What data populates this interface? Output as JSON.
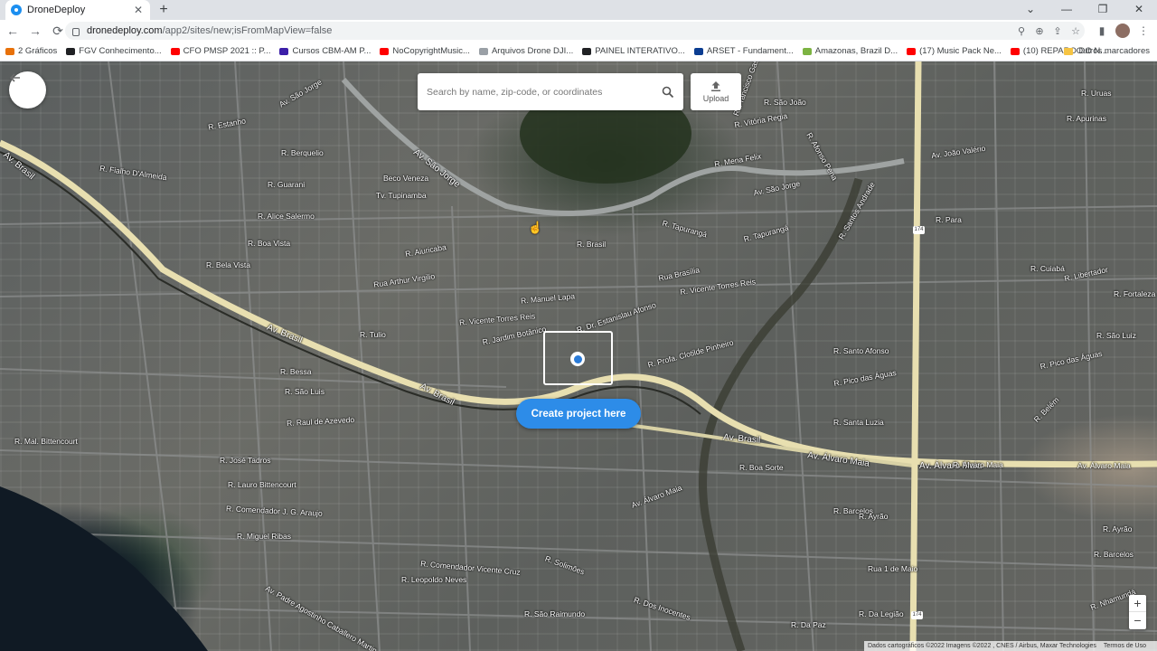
{
  "browser": {
    "tab_title": "DroneDeploy",
    "tab_close": "✕",
    "new_tab": "+",
    "url_host": "dronedeploy.com",
    "url_path": "/app2/sites/new;isFromMapView=false",
    "window_controls": {
      "tab_search": "⌄",
      "minimize": "—",
      "restore": "❐",
      "close": "✕"
    },
    "nav": {
      "back": "←",
      "forward": "→",
      "reload": "⟳"
    },
    "omnibox_icons": {
      "location": "⚲",
      "zoom": "⊕",
      "share": "⇪",
      "bookmark": "☆"
    },
    "toolbar_icons": {
      "sidebar": "▮",
      "menu": "⋮"
    }
  },
  "bookmarks": {
    "items": [
      {
        "label": "2 Gráficos",
        "color": "#e8710a"
      },
      {
        "label": "FGV Conhecimento...",
        "color": "#202124"
      },
      {
        "label": "CFO PMSP 2021 :: P...",
        "color": "#ff0000"
      },
      {
        "label": "Cursos CBM-AM P...",
        "color": "#3c1fa8"
      },
      {
        "label": "NoCopyrightMusic...",
        "color": "#ff0000"
      },
      {
        "label": "Arquivos Drone DJI...",
        "color": "#9aa0a6"
      },
      {
        "label": "PAINEL INTERATIVO...",
        "color": "#202124"
      },
      {
        "label": "ARSET - Fundament...",
        "color": "#0b3d91"
      },
      {
        "label": "Amazonas, Brazil D...",
        "color": "#7cb342"
      },
      {
        "label": "(17) Music Pack Ne...",
        "color": "#ff0000"
      },
      {
        "label": "(10) REPARO DO N...",
        "color": "#ff0000"
      }
    ],
    "more": "»",
    "other": "Outros marcadores"
  },
  "map": {
    "search_placeholder": "Search by name, zip-code, or coordinates",
    "upload_label": "Upload",
    "create_project_label": "Create project here",
    "zoom_in": "+",
    "zoom_out": "−",
    "route_badge": "174",
    "attribution": {
      "data": "Dados cartográficos ©2022 Imagens ©2022 , CNES / Airbus, Maxar Technologies",
      "terms": "Termos de Uso"
    },
    "streets": [
      "R. Estanho",
      "Av. São Jorge",
      "R. Berquelio",
      "R. Guarani",
      "R. Fialho D'Almeida",
      "Beco Veneza",
      "Tv. Tupinamba",
      "R. Alice Salermo",
      "R. Boa Vista",
      "R. Bela Vista",
      "R. Aiuricaba",
      "Rua Arthur Virgilio",
      "R. Brasil",
      "R. Tapurangá",
      "R. Tapurangá",
      "R. Vitória Regia",
      "R. Mena Felix",
      "Av. São Jorge",
      "R. Santos Andrade",
      "Rua Brasília",
      "R. Vicente Torres Reis",
      "R. Manuel Lapa",
      "R. Vicente Torres Reis",
      "R. Jardim Botânico",
      "R. Dr. Estanislau Afonso",
      "R. Profa. Clotilde Pinheiro",
      "R. Tulio",
      "R. Bessa",
      "R. São Luis",
      "R. Raul de Azevedo",
      "R. Mal. Bittencourt",
      "R. José Tadros",
      "R. Lauro Bittencourt",
      "R. Comendador J. G. Araujo",
      "R. Miguel Ribas",
      "R. Comendador Vicente Cruz",
      "R. Leopoldo Neves",
      "Av. Padre Agostinho Caballero Martin",
      "R. Santo Afonso",
      "R. Pico das Águas",
      "R. Santa Luzia",
      "R. Boa Sorte",
      "R. Barcelos",
      "Rua 1 de Maio",
      "R. Da Paz",
      "R. Solimões",
      "R. Dos Inocentes",
      "R. São Raimundo",
      "R. Para",
      "R. Cuiabá",
      "R. Libertador",
      "R. Fortaleza",
      "R. Pico das Águas",
      "R. Belém",
      "R. São Luiz",
      "R. Nhamundá",
      "Av. João Valério",
      "R. Apurinas",
      "R. Uruas",
      "R. São João",
      "R. Francisco Gaspar",
      "R. Afonso Pena",
      "Av. Álvaro Maia",
      "Av. Álvaro Maia",
      "R. Álvaro Maia",
      "R. Ayrão",
      "R. Ayrão",
      "R. Barcelos",
      "R. Da Legião"
    ],
    "avenues": [
      "Av. Brasil",
      "Av. Brasil",
      "Av. Brasil",
      "Av. Brasil",
      "Av. Álvaro Maia",
      "Av. São Jorge",
      "Av. Álvaro Maia"
    ]
  }
}
